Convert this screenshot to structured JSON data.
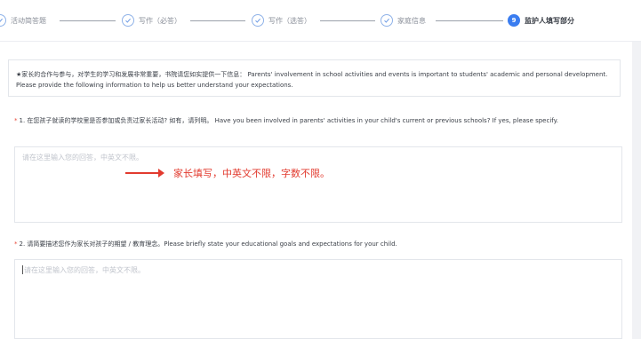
{
  "stepper": {
    "steps": [
      {
        "label": "活动简答题",
        "state": "done"
      },
      {
        "label": "写作（必答）",
        "state": "done"
      },
      {
        "label": "写作（选答）",
        "state": "done"
      },
      {
        "label": "家庭信息",
        "state": "done"
      },
      {
        "label": "监护人填写部分",
        "state": "active",
        "number": "9"
      }
    ]
  },
  "notice": {
    "text": "★家长的合作与参与，对学生的学习和发展非常重要，书院请您如实提供一下信息： Parents' involvement in school activities and events is important to students' academic and personal development. Please provide the following information to help us better understand your expectations."
  },
  "questions": [
    {
      "required_mark": "*",
      "text": "1. 在您孩子就读的学校里是否参加或负责过家长活动? 如有，请列明。 Have you been involved in parents' activities in your child's current or previous schools? If yes, please specify.",
      "placeholder": "请在这里输入您的回答，中英文不限。"
    },
    {
      "required_mark": "*",
      "text": "2. 请简要描述您作为家长对孩子的期望 / 教育理念。Please briefly state your educational goals and expectations for your child.",
      "placeholder": "请在这里输入您的回答，中英文不限。"
    }
  ],
  "annotation": {
    "text": "家长填写，中英文不限，字数不限。",
    "color": "#e23a2e"
  },
  "colors": {
    "accent": "#3a7df0",
    "required": "#e84a3a"
  }
}
